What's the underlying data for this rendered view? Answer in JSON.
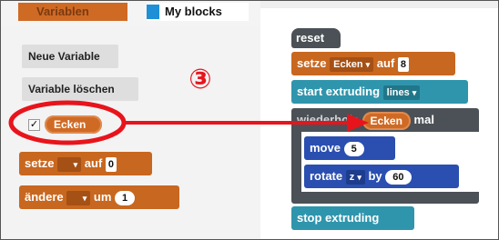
{
  "categories": {
    "variablen": "Variablen",
    "my_blocks": "My blocks"
  },
  "palette": {
    "new_variable_button": "Neue Variable",
    "delete_variable_button": "Variable löschen",
    "checkbox_mark": "✓",
    "variable_reporter": "Ecken",
    "setze_block": {
      "keyword": "setze",
      "dropdown_arrow": "▾",
      "auf": "auf",
      "value": "0"
    },
    "andere_block": {
      "keyword": "ändere",
      "dropdown_arrow": "▾",
      "um": "um",
      "value": "1"
    }
  },
  "workspace": {
    "hat_label": "reset",
    "setze_block": {
      "keyword": "setze",
      "variable": "Ecken",
      "dropdown_arrow": "▾",
      "auf": "auf",
      "value": "8"
    },
    "start_block": {
      "label": "start extruding",
      "mode": "lines",
      "dropdown_arrow": "▾"
    },
    "repeat_block": {
      "prefix": "wiederhole",
      "variable": "Ecken",
      "suffix": "mal"
    },
    "move_block": {
      "label": "move",
      "value": "5"
    },
    "rotate_block": {
      "label": "rotate",
      "axis": "z",
      "dropdown_arrow": "▾",
      "by": "by",
      "value": "60"
    },
    "stop_block": {
      "label": "stop extruding"
    }
  },
  "annotation": {
    "step_number": "③",
    "color": "#e8141c"
  },
  "colors": {
    "variables": "#cf6a25",
    "my_blocks": "#1f8fd6",
    "control": "#4b5156",
    "extrude": "#2f95ad",
    "motion": "#2a4fb0"
  }
}
